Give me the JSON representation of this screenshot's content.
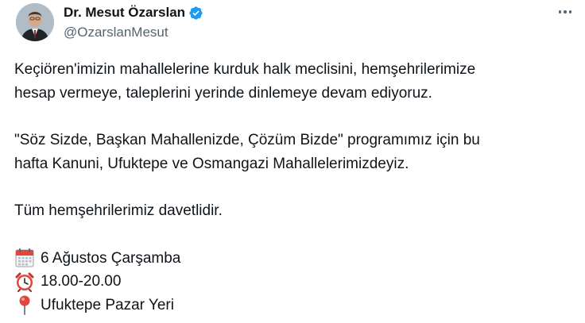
{
  "author": {
    "display_name": "Dr. Mesut Özarslan",
    "handle": "@OzarslanMesut"
  },
  "tweet": {
    "line1": "Keçiören'imizin mahallelerine kurduk halk meclisini, hemşehrilerimize",
    "line2": "hesap vermeye, taleplerini yerinde dinlemeye devam ediyoruz.",
    "line3": "\"Söz Sizde, Başkan Mahallenizde, Çözüm Bizde\" programımız için bu",
    "line4": "hafta Kanuni, Ufuktepe ve Osmangazi Mahallelerimizdeyiz.",
    "line5": "Tüm hemşehrilerimiz davetlidir.",
    "date": "6 Ağustos Çarşamba",
    "time": "18.00-20.00",
    "place": "Ufuktepe Pazar Yeri"
  },
  "colors": {
    "verified": "#1d9bf0",
    "text": "#0f1419",
    "secondary": "#536471"
  },
  "icons": {
    "date": "calendar-icon",
    "time": "alarm-clock-icon",
    "place": "pin-icon",
    "menu": "more-options-icon"
  }
}
